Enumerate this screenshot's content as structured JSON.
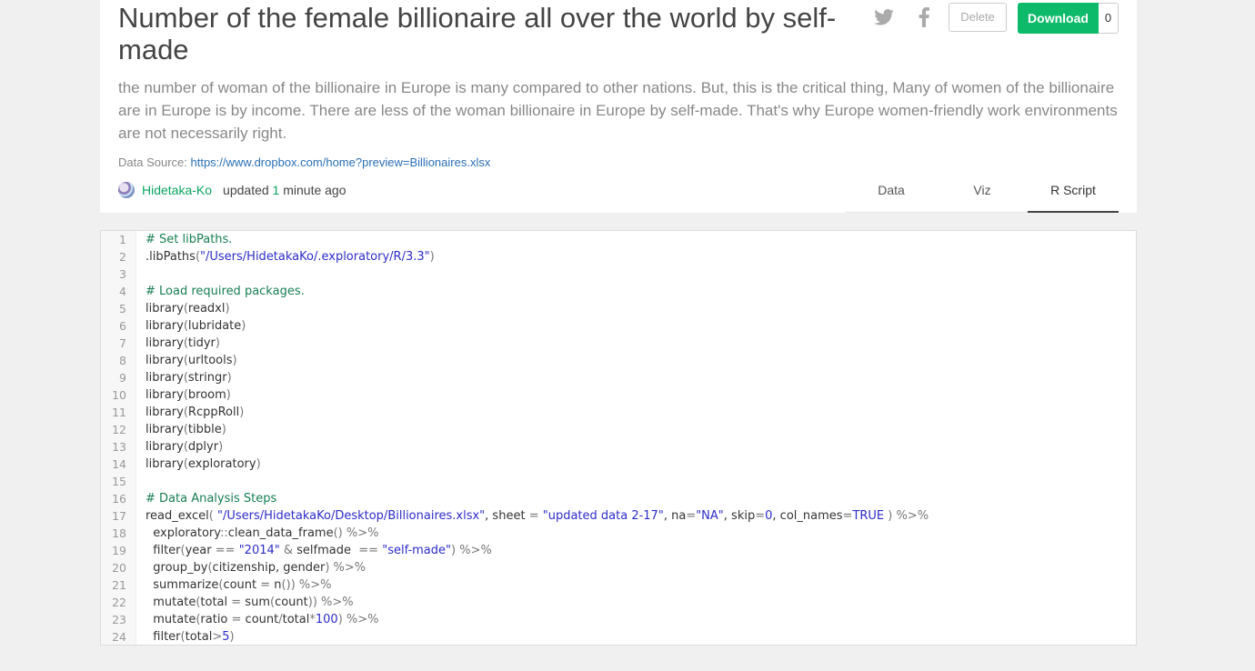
{
  "header": {
    "title": "Number of the female billionaire all over the world by self-made",
    "description": "the number of woman of the billionaire in Europe is many compared to other nations. But, this is the critical thing, Many of women of the billionaire are in Europe is by income. There are less of the woman billionaire in Europe by self-made. That's why Europe women-friendly work environments are not necessarily right.",
    "source_label": "Data Source:",
    "source_url": "https://www.dropbox.com/home?preview=Billionaires.xlsx",
    "author": "Hidetaka-Ko",
    "updated_prefix": "updated",
    "updated_num": "1",
    "updated_suffix": "minute ago"
  },
  "actions": {
    "delete_label": "Delete",
    "download_label": "Download",
    "download_count": "0"
  },
  "tabs": [
    {
      "label": "Data",
      "active": false
    },
    {
      "label": "Viz",
      "active": false
    },
    {
      "label": "R Script",
      "active": true
    }
  ],
  "code": [
    {
      "n": "1",
      "t": "# Set libPaths."
    },
    {
      "n": "2",
      "t": ".libPaths(\"/Users/HidetakaKo/.exploratory/R/3.3\")"
    },
    {
      "n": "3",
      "t": ""
    },
    {
      "n": "4",
      "t": "# Load required packages."
    },
    {
      "n": "5",
      "t": "library(readxl)"
    },
    {
      "n": "6",
      "t": "library(lubridate)"
    },
    {
      "n": "7",
      "t": "library(tidyr)"
    },
    {
      "n": "8",
      "t": "library(urltools)"
    },
    {
      "n": "9",
      "t": "library(stringr)"
    },
    {
      "n": "10",
      "t": "library(broom)"
    },
    {
      "n": "11",
      "t": "library(RcppRoll)"
    },
    {
      "n": "12",
      "t": "library(tibble)"
    },
    {
      "n": "13",
      "t": "library(dplyr)"
    },
    {
      "n": "14",
      "t": "library(exploratory)"
    },
    {
      "n": "15",
      "t": ""
    },
    {
      "n": "16",
      "t": "# Data Analysis Steps"
    },
    {
      "n": "17",
      "t": "read_excel( \"/Users/HidetakaKo/Desktop/Billionaires.xlsx\", sheet = \"updated data 2-17\", na=\"NA\", skip=0, col_names=TRUE ) %>%"
    },
    {
      "n": "18",
      "t": "  exploratory::clean_data_frame() %>%"
    },
    {
      "n": "19",
      "t": "  filter(year == \"2014\" & selfmade  == \"self-made\") %>%"
    },
    {
      "n": "20",
      "t": "  group_by(citizenship, gender) %>%"
    },
    {
      "n": "21",
      "t": "  summarize(count = n()) %>%"
    },
    {
      "n": "22",
      "t": "  mutate(total = sum(count)) %>%"
    },
    {
      "n": "23",
      "t": "  mutate(ratio = count/total*100) %>%"
    },
    {
      "n": "24",
      "t": "  filter(total>5)"
    }
  ],
  "colors": {
    "accent_green": "#0dba6a",
    "link_blue": "#2a6fb5",
    "comment_green": "#167e52",
    "string_blue": "#2c2cc8"
  },
  "icons": [
    "twitter-icon",
    "facebook-icon"
  ]
}
